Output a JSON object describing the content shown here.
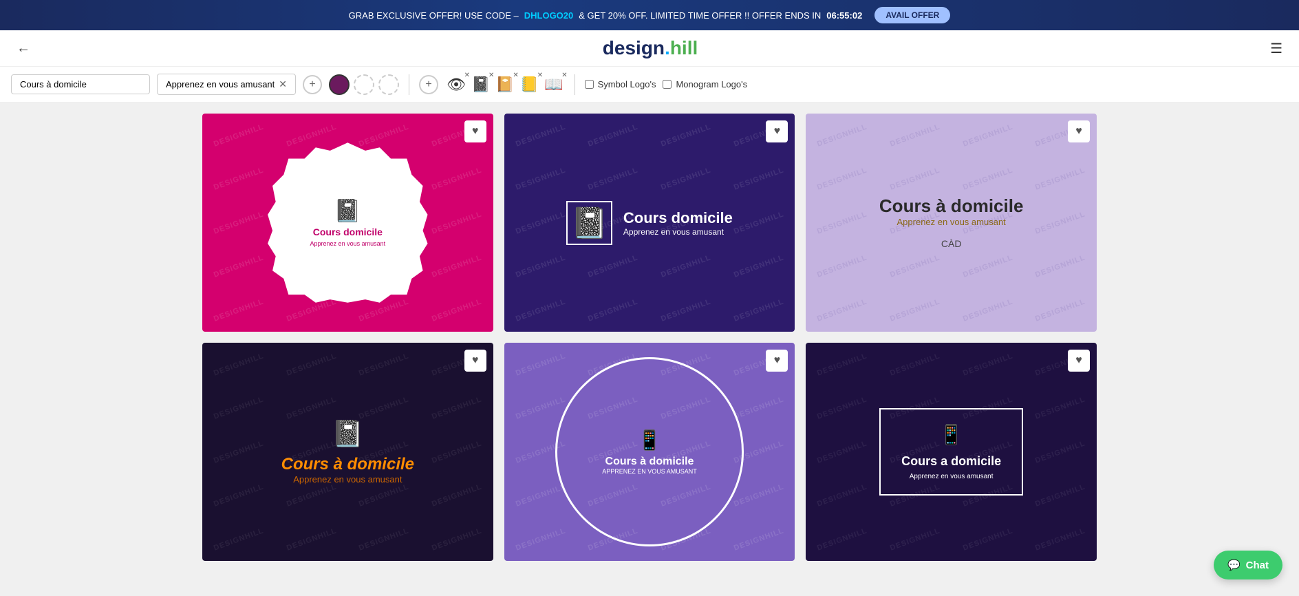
{
  "banner": {
    "text_before": "GRAB EXCLUSIVE OFFER! USE CODE –",
    "code": "DHLOGO20",
    "text_after": "& GET 20% OFF. LIMITED TIME OFFER !! OFFER ENDS IN",
    "timer": "06:55:02",
    "button_label": "AVAIL OFFER"
  },
  "header": {
    "logo_design": "design",
    "logo_hill": "hill",
    "logo_dot": ".",
    "menu_icon": "☰"
  },
  "controls": {
    "input1_value": "Cours à domicile",
    "input2_value": "Apprenez en vous amusant",
    "plus_label": "+",
    "symbol_logos_label": "Symbol Logo's",
    "monogram_logos_label": "Monogram Logo's"
  },
  "colors": {
    "selected": "#6b1a5e",
    "empty1": "#ffffff",
    "empty2": "#ffffff"
  },
  "cards": [
    {
      "id": "card-1",
      "bg": "#d4006e",
      "title": "Cours  domicile",
      "subtitle": "Apprenez en vous amusant",
      "style": "badge"
    },
    {
      "id": "card-2",
      "bg": "#2d1b6b",
      "title": "Cours  domicile",
      "subtitle": "Apprenez en vous amusant",
      "style": "horizontal"
    },
    {
      "id": "card-3",
      "bg": "#c4b3e0",
      "title": "Cours à domicile",
      "subtitle": "Apprenez en vous amusant",
      "abbr": "CÀD",
      "style": "text-center"
    },
    {
      "id": "card-4",
      "bg": "#1a1030",
      "title": "Cours à domicile",
      "subtitle": "Apprenez en vous amusant",
      "style": "dark-orange"
    },
    {
      "id": "card-5",
      "bg": "#7b5fc0",
      "title": "Cours à domicile",
      "subtitle": "APPRENEZ EN VOUS AMUSANT",
      "style": "circle"
    },
    {
      "id": "card-6",
      "bg": "#1e1040",
      "title": "Cours a domicile",
      "subtitle": "Apprenez en vous amusant",
      "style": "rect-border"
    }
  ],
  "watermark": "DESIGNHILL",
  "chat": {
    "label": "Chat",
    "icon": "💬"
  }
}
